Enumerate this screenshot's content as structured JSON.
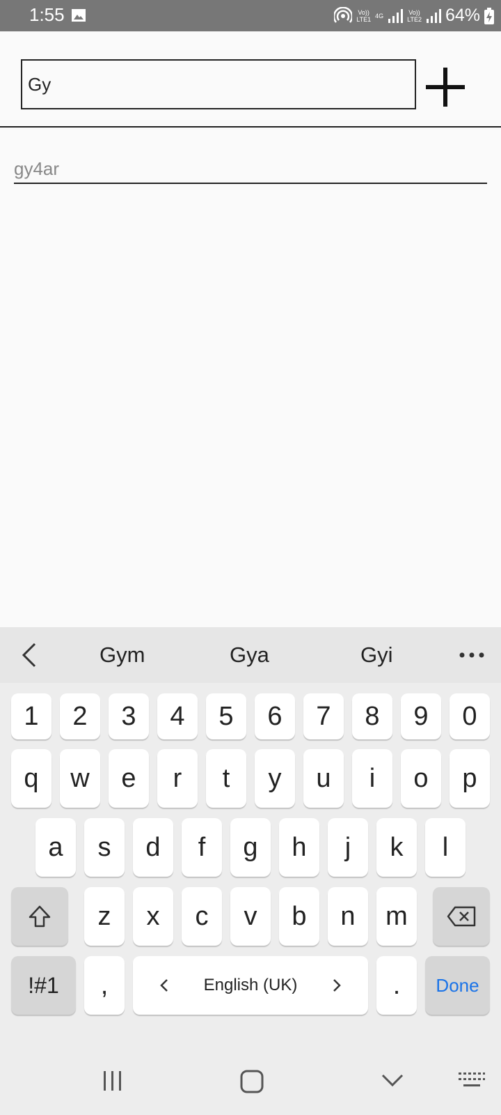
{
  "status_bar": {
    "time": "1:55",
    "sim1_top": "Vo))",
    "sim1_bottom": "LTE1",
    "network": "4G",
    "sim2_top": "Vo))",
    "sim2_bottom": "LTE2",
    "battery_percent": "64%"
  },
  "task_input": {
    "value": "Gy"
  },
  "task_list": [
    {
      "label": "gy4ar"
    }
  ],
  "suggestions": [
    "Gym",
    "Gya",
    "Gyi"
  ],
  "keyboard": {
    "number_row": [
      "1",
      "2",
      "3",
      "4",
      "5",
      "6",
      "7",
      "8",
      "9",
      "0"
    ],
    "row1": [
      "q",
      "w",
      "e",
      "r",
      "t",
      "y",
      "u",
      "i",
      "o",
      "p"
    ],
    "row2": [
      "a",
      "s",
      "d",
      "f",
      "g",
      "h",
      "j",
      "k",
      "l"
    ],
    "row3": [
      "z",
      "x",
      "c",
      "v",
      "b",
      "n",
      "m"
    ],
    "symbols_label": "!#1",
    "comma": ",",
    "space_label": "English (UK)",
    "period": ".",
    "done_label": "Done"
  }
}
